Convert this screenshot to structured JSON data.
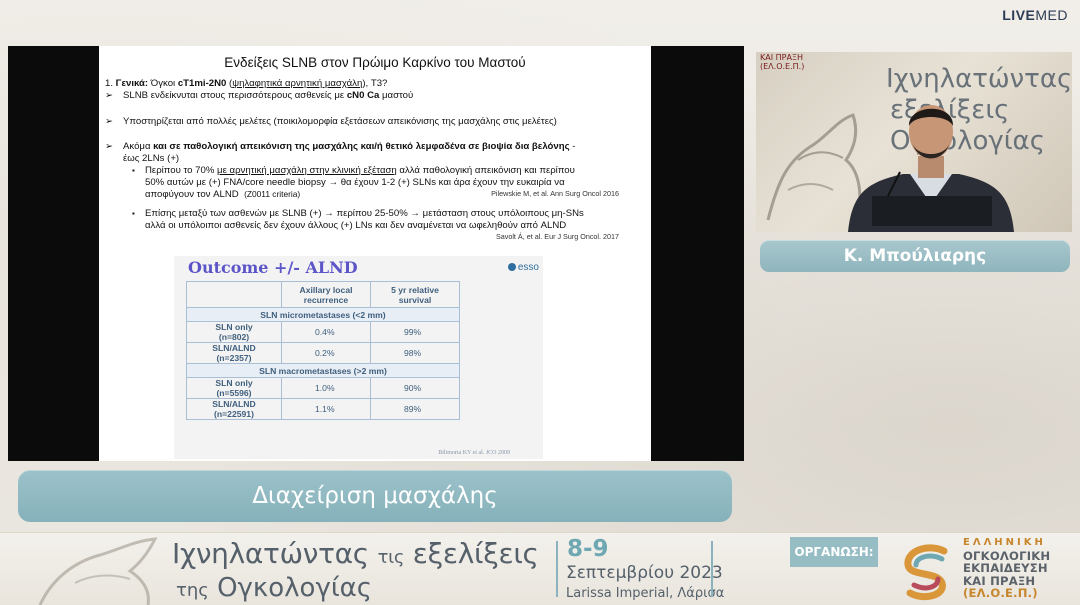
{
  "brand": {
    "live": "LIVE",
    "med": "MED"
  },
  "slide": {
    "title": "Ενδείξεις SLNB στον Πρώιμο Καρκίνο του Μαστού",
    "line1": {
      "prefix": "1. ",
      "bold_label": "Γενικά:",
      "text_a": " Όγκοι ",
      "bold_b": "cT1mi-2N0",
      "text_c": " (",
      "underline_d": "ψηλαφητικά αρνητική μασχάλη",
      "text_e": "), Τ3?"
    },
    "bullet_marker": "➢",
    "square_marker": "▪",
    "line2": {
      "text_a": "SLNB ενδείκνυται στους περισσότερους ασθενείς με ",
      "bold_b": "cN0 Ca",
      "text_c": " μαστού"
    },
    "line3": "Υποστηρίζεται από πολλές μελέτες (ποικιλομορφία εξετάσεων απεικόνισης της μασχάλης στις μελέτες)",
    "line4": {
      "text_a": "Ακόμα ",
      "bold_b": "και σε παθολογική απεικόνιση της μασχάλης και/ή θετικό λεμφαδένα σε βιοψία δια βελόνης",
      "text_c": " -",
      "line2": "έως 2LNs (+)"
    },
    "sub1": {
      "text_a": "Περίπου το 70% ",
      "underline_b": "με αρνητική μασχάλη στην κλινική εξέταση",
      "text_c": " αλλά παθολογική απεικόνιση και περίπου",
      "line2": "50% αυτών με (+) FNA/core needle biopsy → θα έχουν 1-2 (+) SLNs και άρα έχουν την ευκαιρία να",
      "line3_a": "αποφύγουν τον ALND",
      "line3_b": "(Z0011 criteria)",
      "cite": "Pilewskie M, et al. Ann Surg Oncol 2016"
    },
    "sub2": {
      "line1": "Επίσης μεταξύ των ασθενών με SLNB (+) → περίπου 25-50% → μετάσταση στους υπόλοιπους μη-SNs",
      "line2": "αλλά οι υπόλοιποι ασθενείς δεν έχουν άλλους (+) LNs και δεν αναμένεται να ωφεληθούν από ALND",
      "cite": "Savolt Á, et al. Eur J Surg Oncol. 2017"
    },
    "embedded": {
      "title": "Outcome +/- ALND",
      "logo": "esso",
      "headers": [
        "",
        "Axillary local recurrence",
        "5 yr relative survival"
      ],
      "band1": "SLN micrometastases (<2 mm)",
      "rows1": [
        {
          "label": "SLN only",
          "n": "(n=802)",
          "recurrence": "0.4%",
          "survival": "99%"
        },
        {
          "label": "SLN/ALND",
          "n": "(n=2357)",
          "recurrence": "0.2%",
          "survival": "98%"
        }
      ],
      "band2": "SLN macrometastases (>2 mm)",
      "rows2": [
        {
          "label": "SLN only",
          "n": "(n=5596)",
          "recurrence": "1.0%",
          "survival": "90%"
        },
        {
          "label": "SLN/ALND",
          "n": "(n=22591)",
          "recurrence": "1.1%",
          "survival": "89%"
        }
      ],
      "cite": "Bilimoria KY et al. JCO 2009"
    }
  },
  "video": {
    "poster_lines": [
      "Ιχνηλατώντας",
      "εξελίξεις",
      "Ογκολογίας"
    ],
    "org_top": [
      "ΚΑΙ ΠΡΑΞΗ",
      "(ΕΛ.Ο.Ε.Π.)"
    ]
  },
  "speaker_name": "Κ. Μπούλιαρης",
  "topic": "Διαχείριση μασχάλης",
  "footer": {
    "title_a": "Ιχνηλατώντας",
    "title_b": "τις",
    "title_c": "εξελίξεις",
    "title_d": "της",
    "title_e": "Ογκολογίας",
    "dates": "8-9",
    "month": "Σεπτεμβρίου 2023",
    "venue": "Larissa Imperial, Λάρισα",
    "org_label": "ΟΡΓΑΝΩΣΗ:",
    "org_lines": [
      "ΕΛΛΗΝΙΚΗ",
      "ΟΓΚΟΛΟΓΙΚΗ",
      "ΕΚΠΑΙΔΕΥΣΗ",
      "ΚΑΙ ΠΡΑΞΗ",
      "(ΕΛ.Ο.Ε.Π.)"
    ]
  },
  "colors": {
    "caption_teal": "#8fb5bd",
    "embedded_title_purple": "#5c55c8",
    "footer_text": "#55606a",
    "org_orange": "#c7862c"
  }
}
